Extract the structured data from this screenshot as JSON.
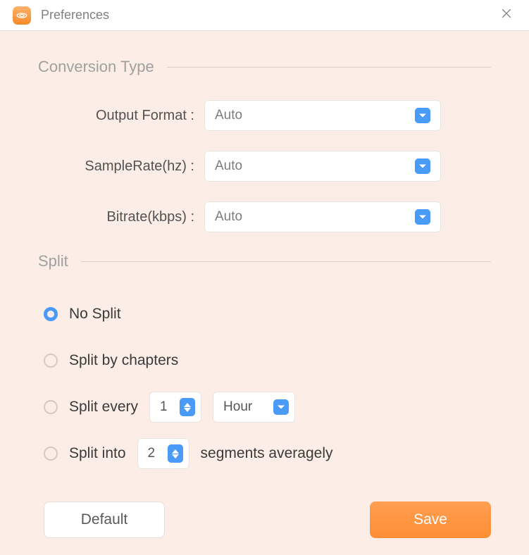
{
  "window": {
    "title": "Preferences"
  },
  "sections": {
    "conversion": {
      "title": "Conversion Type"
    },
    "split": {
      "title": "Split"
    }
  },
  "fields": {
    "outputFormat": {
      "label": "Output Format :",
      "value": "Auto"
    },
    "sampleRate": {
      "label": "SampleRate(hz) :",
      "value": "Auto"
    },
    "bitrate": {
      "label": "Bitrate(kbps) :",
      "value": "Auto"
    }
  },
  "split": {
    "options": {
      "noSplit": {
        "label": "No Split",
        "selected": true
      },
      "byChapters": {
        "label": "Split by chapters",
        "selected": false
      },
      "every": {
        "label": "Split every",
        "value": "1",
        "unit": "Hour",
        "selected": false
      },
      "into": {
        "label": "Split into",
        "value": "2",
        "suffix": "segments averagely",
        "selected": false
      }
    }
  },
  "buttons": {
    "default": "Default",
    "save": "Save"
  }
}
